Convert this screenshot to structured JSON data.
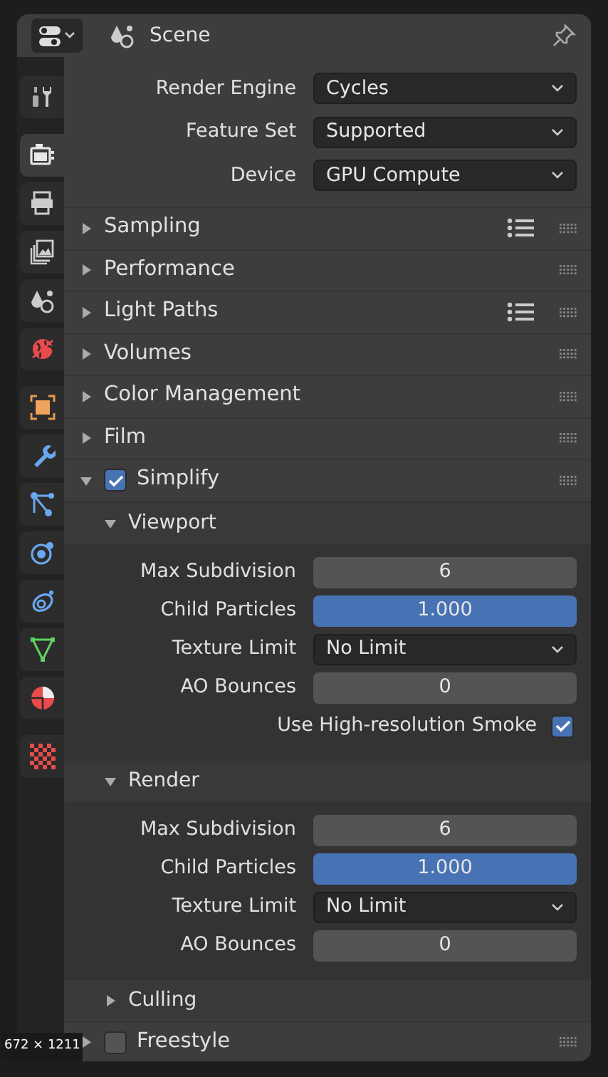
{
  "header": {
    "title": "Scene"
  },
  "sidebar": {
    "groups": [
      [
        {
          "kind": "tool",
          "selected": false
        }
      ],
      [
        {
          "kind": "render",
          "selected": true
        },
        {
          "kind": "output",
          "selected": false
        },
        {
          "kind": "view_layer",
          "selected": false
        },
        {
          "kind": "scene",
          "selected": false
        },
        {
          "kind": "world",
          "selected": false
        }
      ],
      [
        {
          "kind": "object",
          "selected": false
        },
        {
          "kind": "modifier",
          "selected": false
        },
        {
          "kind": "particles",
          "selected": false
        },
        {
          "kind": "physics",
          "selected": false
        },
        {
          "kind": "constraints",
          "selected": false
        },
        {
          "kind": "data",
          "selected": false
        },
        {
          "kind": "material",
          "selected": false
        }
      ],
      [
        {
          "kind": "texture",
          "selected": false
        }
      ]
    ]
  },
  "properties": [
    {
      "label": "Render Engine",
      "kind": "dropdown",
      "value": "Cycles"
    },
    {
      "label": "Feature Set",
      "kind": "dropdown",
      "value": "Supported"
    },
    {
      "label": "Device",
      "kind": "dropdown",
      "value": "GPU Compute"
    }
  ],
  "panels": [
    {
      "title": "Sampling",
      "expanded": false,
      "presets": true
    },
    {
      "title": "Performance",
      "expanded": false,
      "presets": false
    },
    {
      "title": "Light Paths",
      "expanded": false,
      "presets": true
    },
    {
      "title": "Volumes",
      "expanded": false,
      "presets": false
    },
    {
      "title": "Color Management",
      "expanded": false,
      "presets": false
    },
    {
      "title": "Film",
      "expanded": false,
      "presets": false
    },
    {
      "title": "Simplify",
      "expanded": true,
      "presets": false,
      "checked": true,
      "subpanels": [
        {
          "title": "Viewport",
          "expanded": true,
          "fields": [
            {
              "label": "Max Subdivision",
              "kind": "number",
              "value": "6"
            },
            {
              "label": "Child Particles",
              "kind": "slider",
              "value": "1.000",
              "level": 1.0
            },
            {
              "label": "Texture Limit",
              "kind": "dropdown",
              "value": "No Limit"
            },
            {
              "label": "AO Bounces",
              "kind": "number",
              "value": "0"
            },
            {
              "label": "Use High-resolution Smoke",
              "kind": "checkbox",
              "checked": true
            }
          ]
        },
        {
          "title": "Render",
          "expanded": true,
          "fields": [
            {
              "label": "Max Subdivision",
              "kind": "number",
              "value": "6"
            },
            {
              "label": "Child Particles",
              "kind": "slider",
              "value": "1.000",
              "level": 1.0
            },
            {
              "label": "Texture Limit",
              "kind": "dropdown",
              "value": "No Limit"
            },
            {
              "label": "AO Bounces",
              "kind": "number",
              "value": "0"
            }
          ]
        },
        {
          "title": "Culling",
          "expanded": false
        }
      ]
    },
    {
      "title": "Freestyle",
      "expanded": false,
      "presets": false,
      "checked": false
    }
  ],
  "size_badge": "672 × 1211"
}
